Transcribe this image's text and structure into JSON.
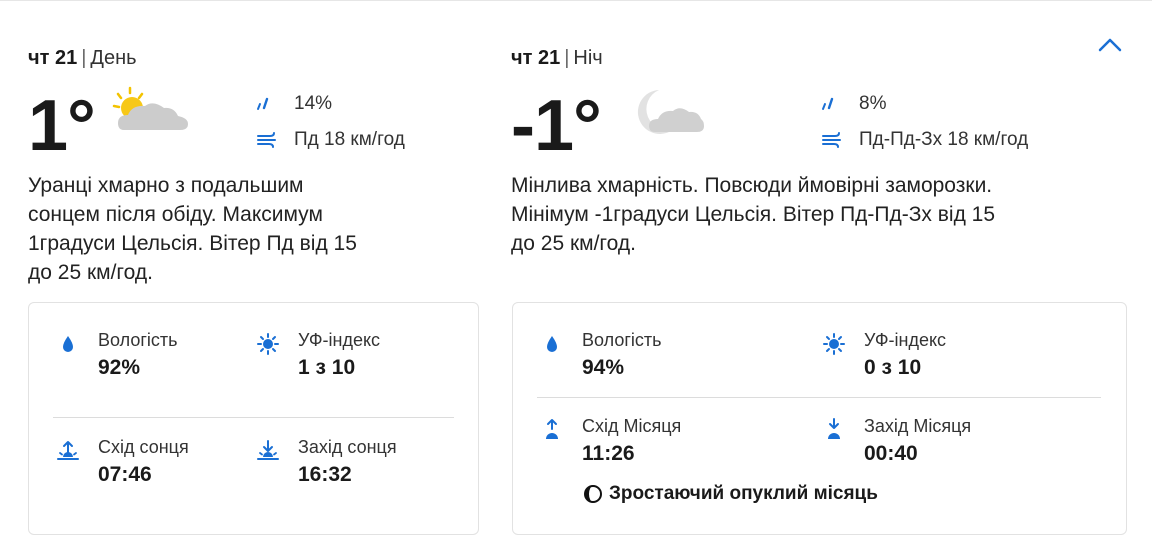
{
  "day": {
    "date": "чт 21",
    "separator": "|",
    "period": "День",
    "temperature": "1°",
    "icon": "partly-sunny-cloud-icon",
    "precipitation": "14%",
    "wind": "Пд 18 км/год",
    "description": [
      "Уранці хмарно з подальшим",
      "сонцем після обіду. Максимум",
      "1градуси Цельсія. Вітер Пд від 15",
      "до 25 км/год."
    ],
    "details": {
      "humidity_label": "Вологість",
      "humidity_value": "92%",
      "uv_label": "УФ-індекс",
      "uv_value": "1 з 10",
      "sunrise_label": "Схід сонця",
      "sunrise_value": "07:46",
      "sunset_label": "Захід сонця",
      "sunset_value": "16:32"
    }
  },
  "night": {
    "date": "чт 21",
    "separator": "|",
    "period": "Ніч",
    "temperature": "-1°",
    "icon": "moon-cloud-icon",
    "precipitation": "8%",
    "wind": "Пд-Пд-Зх 18 км/год",
    "description": [
      "Мінлива хмарність. Повсюди ймовірні заморозки.",
      "Мінімум -1градуси Цельсія. Вітер Пд-Пд-Зх від 15",
      "до 25 км/год."
    ],
    "details": {
      "humidity_label": "Вологість",
      "humidity_value": "94%",
      "uv_label": "УФ-індекс",
      "uv_value": "0 з 10",
      "moonrise_label": "Схід Місяця",
      "moonrise_value": "11:26",
      "moonset_label": "Захід Місяця",
      "moonset_value": "00:40",
      "moon_phase": "Зростаючий опуклий місяць"
    }
  },
  "colors": {
    "accent": "#1a6fd4",
    "text": "#1a1a1a",
    "border": "#e2e2e2"
  },
  "icons": {
    "collapse": "chevron-up-icon",
    "precipitation": "raindrops-icon",
    "wind": "wind-icon",
    "humidity": "drop-icon",
    "uv": "sun-icon",
    "sunrise": "sunrise-icon",
    "sunset": "sunset-icon",
    "moonrise": "moonrise-icon",
    "moonset": "moonset-icon",
    "moon_phase": "moon-phase-icon"
  }
}
